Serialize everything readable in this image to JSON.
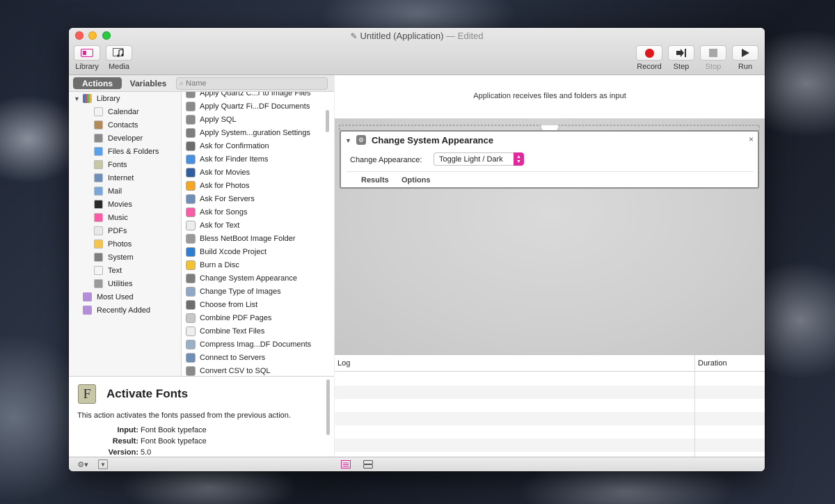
{
  "window": {
    "title": "Untitled (Application)",
    "edited": "— Edited"
  },
  "toolbar": {
    "library_label": "Library",
    "media_label": "Media",
    "record_label": "Record",
    "step_label": "Step",
    "stop_label": "Stop",
    "run_label": "Run"
  },
  "tabs": {
    "actions": "Actions",
    "variables": "Variables"
  },
  "search": {
    "placeholder": "Name"
  },
  "library": {
    "root": "Library",
    "items": [
      {
        "label": "Calendar",
        "icon": "calendar-icon"
      },
      {
        "label": "Contacts",
        "icon": "contacts-icon"
      },
      {
        "label": "Developer",
        "icon": "developer-icon"
      },
      {
        "label": "Files & Folders",
        "icon": "finder-icon"
      },
      {
        "label": "Fonts",
        "icon": "fonts-icon"
      },
      {
        "label": "Internet",
        "icon": "globe-icon"
      },
      {
        "label": "Mail",
        "icon": "mail-icon"
      },
      {
        "label": "Movies",
        "icon": "movies-icon"
      },
      {
        "label": "Music",
        "icon": "music-icon"
      },
      {
        "label": "PDFs",
        "icon": "pdf-icon"
      },
      {
        "label": "Photos",
        "icon": "photos-icon"
      },
      {
        "label": "System",
        "icon": "system-icon"
      },
      {
        "label": "Text",
        "icon": "text-icon"
      },
      {
        "label": "Utilities",
        "icon": "utilities-icon"
      }
    ],
    "smart_groups": [
      {
        "label": "Most Used",
        "icon": "smart-folder-icon"
      },
      {
        "label": "Recently Added",
        "icon": "smart-folder-icon"
      }
    ]
  },
  "actions": [
    "Apply Quartz C...r to Image Files",
    "Apply Quartz Fi...DF Documents",
    "Apply SQL",
    "Apply System...guration Settings",
    "Ask for Confirmation",
    "Ask for Finder Items",
    "Ask for Movies",
    "Ask for Photos",
    "Ask For Servers",
    "Ask for Songs",
    "Ask for Text",
    "Bless NetBoot Image Folder",
    "Build Xcode Project",
    "Burn a Disc",
    "Change System Appearance",
    "Change Type of Images",
    "Choose from List",
    "Combine PDF Pages",
    "Combine Text Files",
    "Compress Imag...DF Documents",
    "Connect to Servers",
    "Convert CSV to SQL"
  ],
  "description": {
    "title": "Activate Fonts",
    "text": "This action activates the fonts passed from the previous action.",
    "input_label": "Input:",
    "input_value": "Font Book typeface",
    "result_label": "Result:",
    "result_value": "Font Book typeface",
    "version_label": "Version:",
    "version_value": "5.0"
  },
  "workflow": {
    "header": "Application receives files and folders as input",
    "action": {
      "title": "Change System Appearance",
      "field_label": "Change Appearance:",
      "field_value": "Toggle Light / Dark",
      "tab_results": "Results",
      "tab_options": "Options"
    }
  },
  "log": {
    "col_log": "Log",
    "col_duration": "Duration"
  },
  "colors": {
    "accent_pink": "#e1299c",
    "record_red": "#e0141b"
  }
}
